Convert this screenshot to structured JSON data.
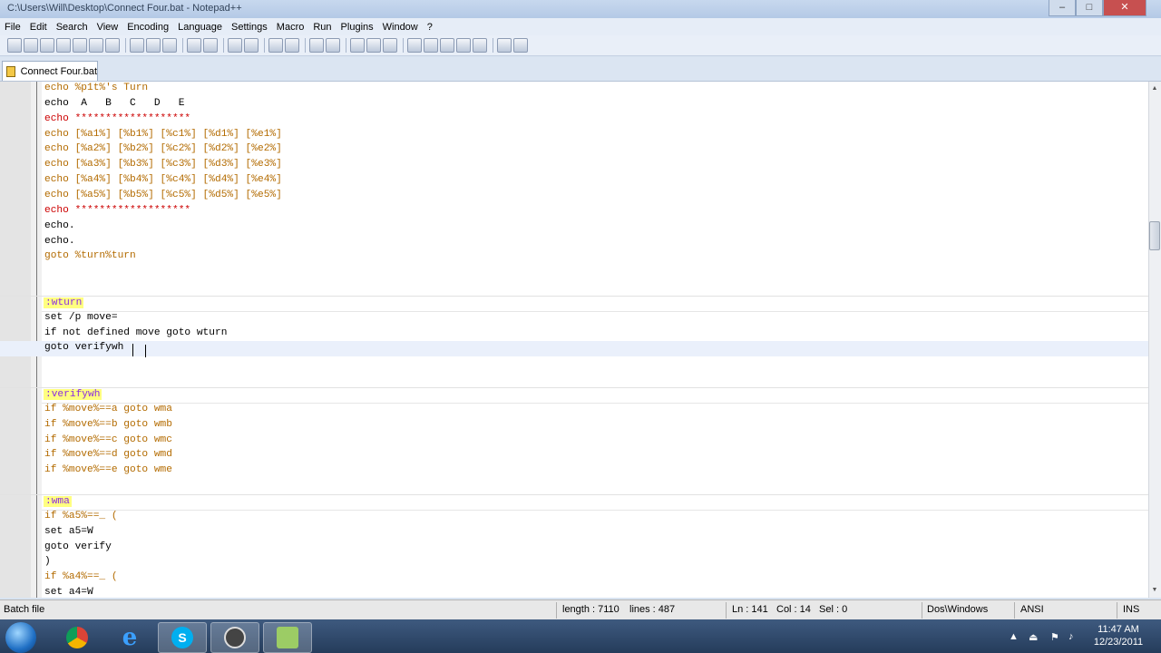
{
  "window": {
    "title": "C:\\Users\\Will\\Desktop\\Connect Four.bat - Notepad++",
    "min_label": "–",
    "max_label": "□",
    "close_label": "✕"
  },
  "menu": [
    "File",
    "Edit",
    "Search",
    "View",
    "Encoding",
    "Language",
    "Settings",
    "Macro",
    "Run",
    "Plugins",
    "Window",
    "?"
  ],
  "tab": {
    "label": "Connect Four.bat"
  },
  "editor": {
    "lines": [
      {
        "text": "echo %p1t%'s Turn",
        "kind": "vars"
      },
      {
        "text": "echo  A   B   C   D   E",
        "kind": "plain"
      },
      {
        "text": "echo *******************",
        "kind": "stars"
      },
      {
        "text": "echo [%a1%] [%b1%] [%c1%] [%d1%] [%e1%]",
        "kind": "vars"
      },
      {
        "text": "echo [%a2%] [%b2%] [%c2%] [%d2%] [%e2%]",
        "kind": "vars"
      },
      {
        "text": "echo [%a3%] [%b3%] [%c3%] [%d3%] [%e3%]",
        "kind": "vars"
      },
      {
        "text": "echo [%a4%] [%b4%] [%c4%] [%d4%] [%e4%]",
        "kind": "vars"
      },
      {
        "text": "echo [%a5%] [%b5%] [%c5%] [%d5%] [%e5%]",
        "kind": "vars"
      },
      {
        "text": "echo *******************",
        "kind": "stars"
      },
      {
        "text": "echo.",
        "kind": "plain"
      },
      {
        "text": "echo.",
        "kind": "plain"
      },
      {
        "text": "goto %turn%turn",
        "kind": "vars"
      },
      {
        "text": "",
        "kind": "plain"
      },
      {
        "text": "",
        "kind": "plain"
      },
      {
        "text": ":wturn",
        "kind": "label"
      },
      {
        "text": "set /p move=",
        "kind": "plain"
      },
      {
        "text": "if not defined move goto wturn",
        "kind": "plain"
      },
      {
        "text": "goto verifywh",
        "kind": "current"
      },
      {
        "text": "",
        "kind": "plain"
      },
      {
        "text": "",
        "kind": "plain"
      },
      {
        "text": ":verifywh",
        "kind": "label"
      },
      {
        "text": "if %move%==a goto wma",
        "kind": "vars"
      },
      {
        "text": "if %move%==b goto wmb",
        "kind": "vars"
      },
      {
        "text": "if %move%==c goto wmc",
        "kind": "vars"
      },
      {
        "text": "if %move%==d goto wmd",
        "kind": "vars"
      },
      {
        "text": "if %move%==e goto wme",
        "kind": "vars"
      },
      {
        "text": "",
        "kind": "plain"
      },
      {
        "text": ":wma",
        "kind": "label"
      },
      {
        "text": "if %a5%==_ (",
        "kind": "vars"
      },
      {
        "text": "set a5=W",
        "kind": "plain"
      },
      {
        "text": "goto verify",
        "kind": "plain"
      },
      {
        "text": ")",
        "kind": "plain"
      },
      {
        "text": "if %a4%==_ (",
        "kind": "vars"
      },
      {
        "text": "set a4=W",
        "kind": "plain"
      }
    ]
  },
  "status": {
    "file_type": "Batch file",
    "length": "length : 7110",
    "lines": "lines : 487",
    "ln": "Ln : 141",
    "col": "Col : 14",
    "sel": "Sel : 0",
    "eol": "Dos\\Windows",
    "encoding": "ANSI",
    "mode": "INS"
  },
  "taskbar": {
    "time": "11:47 AM",
    "date": "12/23/2011",
    "apps": [
      "chrome-icon",
      "internet-explorer-icon",
      "skype-icon",
      "obs-icon",
      "notepad-plus-plus-icon"
    ]
  },
  "colors": {
    "label_bg": "#ffff80",
    "stars": "#cc0000",
    "variables": "#b36b00"
  }
}
